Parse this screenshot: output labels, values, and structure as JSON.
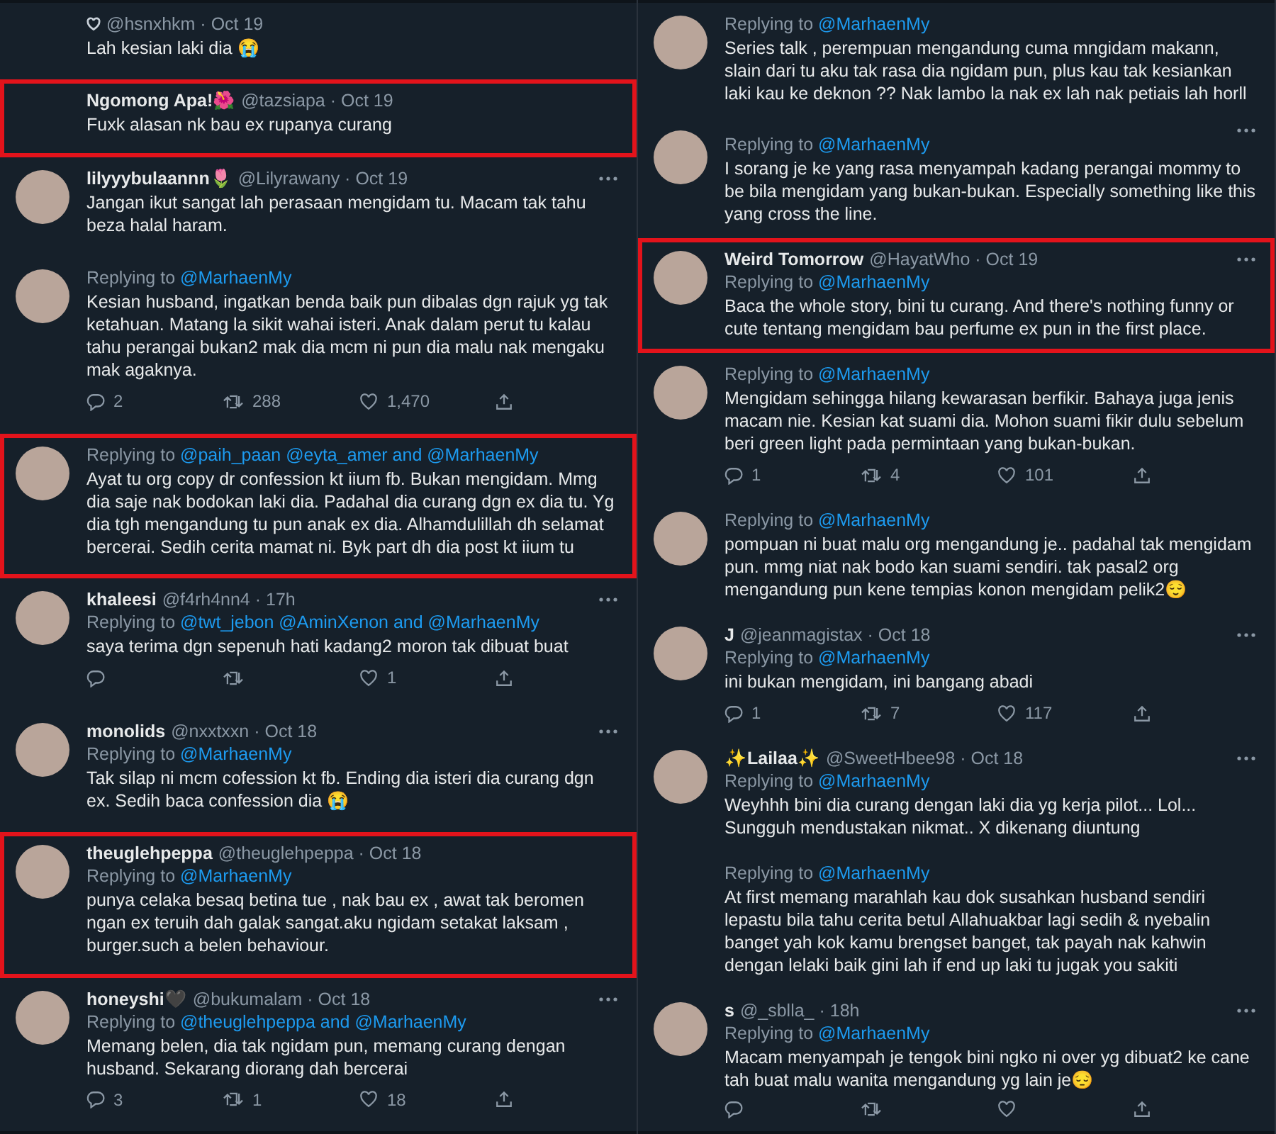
{
  "columns": [
    {
      "tweets": [
        {
          "avatar": false,
          "more": false,
          "highlighted": false,
          "name_icon": true,
          "handle": "@hsnxhkm",
          "time": "· Oct 19",
          "text": "Lah kesian laki dia 😭"
        },
        {
          "avatar": false,
          "more": false,
          "highlighted": true,
          "name": "Ngomong Apa!🌺",
          "handle": "@tazsiapa",
          "time": "· Oct 19",
          "text": "Fuxk alasan nk bau ex rupanya curang"
        },
        {
          "avatar": true,
          "more": true,
          "highlighted": false,
          "name": "lilyyybulaannn🌷",
          "handle": "@Lilyrawany",
          "time": "· Oct 19",
          "text": "Jangan ikut sangat lah perasaan mengidam tu. Macam tak tahu beza halal haram."
        },
        {
          "avatar": true,
          "more": false,
          "highlighted": false,
          "reply_label": "Replying to",
          "reply_to": "@MarhaenMy",
          "text": "Kesian husband, ingatkan benda baik pun dibalas dgn rajuk yg tak ketahuan. Matang la sikit wahai isteri. Anak dalam perut tu kalau tahu perangai bukan2 mak dia mcm ni pun dia malu nak mengaku mak agaknya.",
          "actions": [
            {
              "kind": "reply",
              "count": "2"
            },
            {
              "kind": "retweet",
              "count": "288"
            },
            {
              "kind": "like",
              "count": "1,470"
            },
            {
              "kind": "share"
            }
          ]
        },
        {
          "avatar": true,
          "more": false,
          "highlighted": true,
          "reply_label": "Replying to",
          "reply_to": "@paih_paan @eyta_amer and @MarhaenMy",
          "text": "Ayat tu org copy dr confession kt iium fb. Bukan mengidam. Mmg dia saje nak bodokan laki dia. Padahal dia curang dgn ex dia tu. Yg dia tgh mengandung tu pun anak ex dia. Alhamdulillah dh selamat bercerai. Sedih cerita mamat ni. Byk part dh dia post kt iium tu"
        },
        {
          "avatar": true,
          "more": true,
          "highlighted": false,
          "name": "khaleesi",
          "handle": "@f4rh4nn4",
          "time": "· 17h",
          "reply_label": "Replying to",
          "reply_to": "@twt_jebon @AminXenon and @MarhaenMy",
          "text": "saya terima dgn sepenuh hati kadang2 moron tak dibuat buat",
          "actions": [
            {
              "kind": "reply"
            },
            {
              "kind": "retweet"
            },
            {
              "kind": "like",
              "count": "1"
            },
            {
              "kind": "share"
            }
          ]
        },
        {
          "avatar": true,
          "more": true,
          "highlighted": false,
          "name": "monolids",
          "handle": "@nxxtxxn",
          "time": "· Oct 18",
          "reply_label": "Replying to",
          "reply_to": "@MarhaenMy",
          "text": "Tak silap ni mcm cofession kt fb. Ending dia isteri dia curang dgn ex. Sedih baca confession dia 😭"
        },
        {
          "avatar": true,
          "more": false,
          "highlighted": true,
          "name": "theuglehpeppa",
          "handle": "@theuglehpeppa",
          "time": "· Oct 18",
          "reply_label": "Replying to",
          "reply_to": "@MarhaenMy",
          "text": "punya celaka besaq betina tue , nak bau ex , awat tak beromen ngan ex teruih dah galak sangat.aku ngidam setakat laksam , burger.such a belen behaviour."
        },
        {
          "avatar": true,
          "more": true,
          "highlighted": false,
          "name": "honeyshi🖤",
          "handle": "@bukumalam",
          "time": "· Oct 18",
          "reply_label": "Replying to",
          "reply_to": "@theuglehpeppa and @MarhaenMy",
          "text": "Memang belen, dia tak ngidam pun, memang curang dengan husband. Sekarang diorang dah bercerai",
          "actions": [
            {
              "kind": "reply",
              "count": "3"
            },
            {
              "kind": "retweet",
              "count": "1"
            },
            {
              "kind": "like",
              "count": "18"
            },
            {
              "kind": "share"
            }
          ]
        }
      ]
    },
    {
      "tweets": [
        {
          "avatar": true,
          "more": false,
          "highlighted": false,
          "reply_label": "Replying to",
          "reply_to": "@MarhaenMy",
          "text": "Series talk , perempuan mengandung cuma mngidam makann, slain dari tu aku tak rasa dia ngidam pun, plus kau tak kesiankan laki kau ke deknon ?? Nak lambo la nak ex lah nak petiais lah horll"
        },
        {
          "avatar": true,
          "more": true,
          "highlighted": false,
          "reply_label": "Replying to",
          "reply_to": "@MarhaenMy",
          "text": "I sorang je ke yang rasa menyampah kadang perangai mommy to be bila mengidam yang bukan-bukan. Especially something like this yang cross the line."
        },
        {
          "avatar": true,
          "more": true,
          "highlighted": true,
          "name": "Weird Tomorrow",
          "handle": "@HayatWho",
          "time": "· Oct 19",
          "reply_label": "Replying to",
          "reply_to": "@MarhaenMy",
          "text": "Baca the whole story, bini tu curang. And there's nothing funny or cute tentang mengidam bau perfume ex pun in the first place."
        },
        {
          "avatar": true,
          "more": false,
          "highlighted": false,
          "reply_label": "Replying to",
          "reply_to": "@MarhaenMy",
          "text": "Mengidam sehingga hilang kewarasan berfikir. Bahaya juga jenis macam nie. Kesian kat suami dia. Mohon suami fikir dulu sebelum beri green light pada permintaan yang bukan-bukan.",
          "actions": [
            {
              "kind": "reply",
              "count": "1"
            },
            {
              "kind": "retweet",
              "count": "4"
            },
            {
              "kind": "like",
              "count": "101"
            },
            {
              "kind": "share"
            }
          ]
        },
        {
          "avatar": true,
          "more": false,
          "highlighted": false,
          "reply_label": "Replying to",
          "reply_to": "@MarhaenMy",
          "text": "pompuan ni buat malu org mengandung je.. padahal tak mengidam pun. mmg niat nak bodo kan suami sendiri. tak pasal2 org mengandung pun kene tempias konon mengidam pelik2😌"
        },
        {
          "avatar": true,
          "more": true,
          "highlighted": false,
          "name": "J",
          "handle": "@jeanmagistax",
          "time": "· Oct 18",
          "reply_label": "Replying to",
          "reply_to": "@MarhaenMy",
          "text": "ini bukan mengidam, ini bangang abadi",
          "actions": [
            {
              "kind": "reply",
              "count": "1"
            },
            {
              "kind": "retweet",
              "count": "7"
            },
            {
              "kind": "like",
              "count": "117"
            },
            {
              "kind": "share"
            }
          ]
        },
        {
          "avatar": true,
          "more": true,
          "highlighted": false,
          "name": "✨Lailaa✨",
          "handle": "@SweetHbee98",
          "time": "· Oct 18",
          "reply_label": "Replying to",
          "reply_to": "@MarhaenMy",
          "text": "Weyhhh bini dia curang dengan laki dia yg kerja pilot... Lol... Sungguh mendustakan nikmat.. X dikenang diuntung"
        },
        {
          "avatar": false,
          "more": false,
          "highlighted": false,
          "reply_label": "Replying to",
          "reply_to": "@MarhaenMy",
          "text": "At first memang marahlah kau dok susahkan husband sendiri lepastu bila tahu cerita betul Allahuakbar lagi sedih & nyebalin banget yah kok kamu brengset banget, tak payah nak kahwin dengan lelaki baik gini lah if end up laki tu jugak you sakiti"
        },
        {
          "avatar": true,
          "more": true,
          "highlighted": false,
          "name": "s",
          "handle": "@_sblla_",
          "time": "· 18h",
          "reply_label": "Replying to",
          "reply_to": "@MarhaenMy",
          "text": "Macam menyampah je tengok bini ngko ni over yg dibuat2 ke cane tah buat malu wanita mengandung yg lain je😔",
          "actions": [
            {
              "kind": "reply"
            },
            {
              "kind": "retweet"
            },
            {
              "kind": "like"
            },
            {
              "kind": "share"
            }
          ]
        }
      ]
    }
  ]
}
